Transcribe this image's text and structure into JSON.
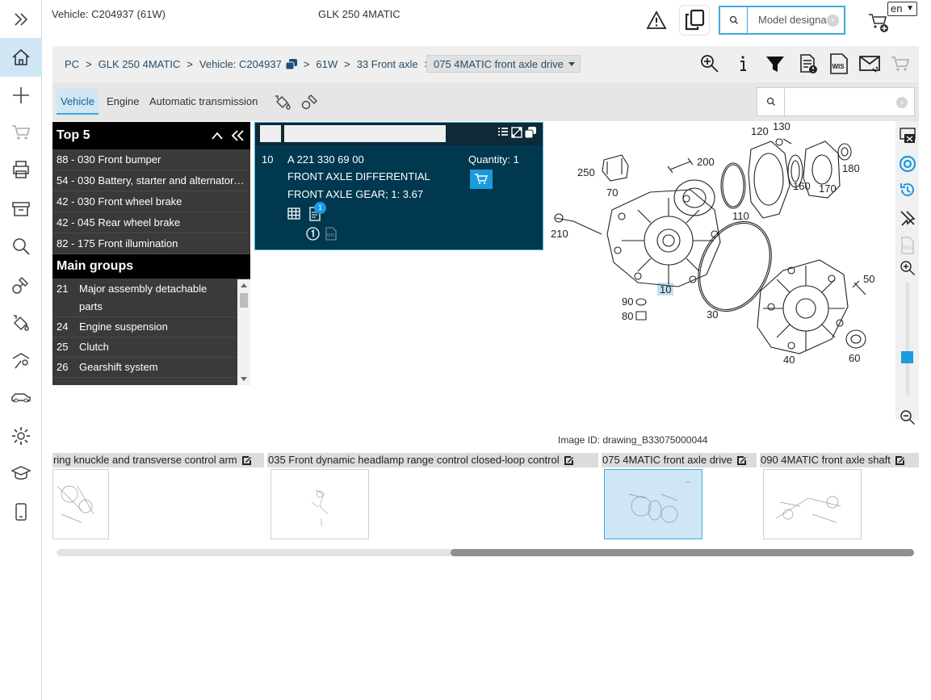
{
  "header": {
    "vehicle": "Vehicle: C204937 (61W)",
    "model": "GLK 250 4MATIC",
    "search_placeholder": "Model designa",
    "language": "en"
  },
  "sidebar": {
    "items": [
      "expand-icon",
      "home-icon",
      "add-icon",
      "cart-icon",
      "print-icon",
      "archive-icon",
      "search-icon",
      "tools-icon",
      "paint-icon",
      "service-icon",
      "car-icon",
      "settings-icon",
      "academy-icon",
      "tablet-icon"
    ]
  },
  "breadcrumb": {
    "items": [
      "PC",
      "GLK 250 4MATIC",
      "Vehicle: C204937",
      "61W",
      "33 Front axle"
    ],
    "current": "075 4MATIC front axle drive"
  },
  "tabs": [
    "Vehicle",
    "Engine",
    "Automatic transmission"
  ],
  "top5": {
    "title": "Top 5",
    "items": [
      "88 - 030 Front bumper",
      "54 - 030 Battery, starter and alternator…",
      "42 - 030 Front wheel brake",
      "42 - 045 Rear wheel brake",
      "82 - 175 Front illumination"
    ]
  },
  "main_groups": {
    "title": "Main groups",
    "items": [
      {
        "num": "21",
        "label": "Major assembly detachable parts"
      },
      {
        "num": "24",
        "label": "Engine suspension"
      },
      {
        "num": "25",
        "label": "Clutch"
      },
      {
        "num": "26",
        "label": "Gearshift system"
      }
    ]
  },
  "part": {
    "position": "10",
    "number": "A 221 330 69 00",
    "desc1": "FRONT AXLE DIFFERENTIAL",
    "desc2": "FRONT AXLE GEAR; 1: 3.67",
    "quantity": "Quantity: 1",
    "badge": "1"
  },
  "diagram": {
    "labels": [
      "130",
      "120",
      "200",
      "250",
      "180",
      "70",
      "160",
      "170",
      "110",
      "210",
      "10",
      "50",
      "90",
      "80",
      "30",
      "60",
      "40"
    ],
    "highlight": "10"
  },
  "image_id": "Image ID: drawing_B33075000044",
  "thumbnails": [
    {
      "caption": "ring knuckle and transverse control arm"
    },
    {
      "caption": "035 Front dynamic headlamp range control closed-loop control"
    },
    {
      "caption": "075 4MATIC front axle drive",
      "selected": true
    },
    {
      "caption": "090 4MATIC front axle shaft"
    }
  ],
  "colors": {
    "accent": "#1a9be0",
    "panel": "#00384f",
    "highlight": "#cfe6f5"
  }
}
